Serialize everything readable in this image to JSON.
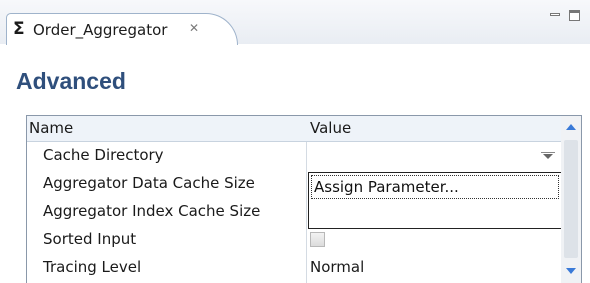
{
  "tab": {
    "icon": "sigma-icon",
    "icon_glyph": "Σ",
    "title": "Order_Aggregator",
    "close_glyph": "✕"
  },
  "section": {
    "title": "Advanced"
  },
  "table": {
    "columns": [
      "Name",
      "Value"
    ],
    "rows": [
      {
        "name": "Cache Directory",
        "value": "",
        "control": "dropdown"
      },
      {
        "name": "Aggregator Data Cache Size",
        "value": "",
        "control": "menu"
      },
      {
        "name": "Aggregator Index Cache Size",
        "value": "",
        "control": "text"
      },
      {
        "name": "Sorted Input",
        "value": "",
        "control": "checkbox",
        "checked": false
      },
      {
        "name": "Tracing Level",
        "value": "Normal",
        "control": "text"
      }
    ]
  },
  "popup_menu": {
    "items": [
      "Assign Parameter..."
    ]
  },
  "colors": {
    "heading": "#2f4f7c",
    "scroll_arrow": "#3a7ad8"
  }
}
